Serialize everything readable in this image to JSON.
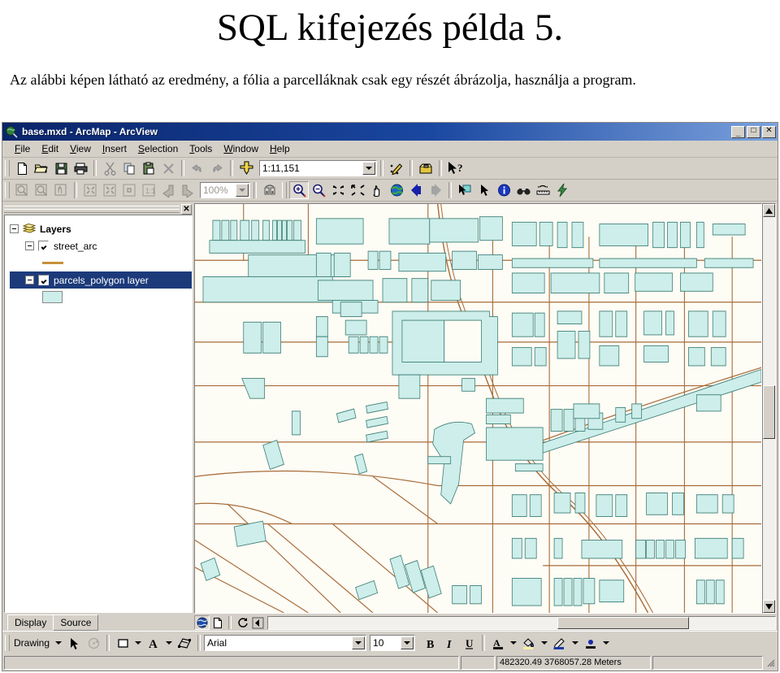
{
  "slide": {
    "title": "SQL kifejezés példa 5.",
    "subtitle": "Az alábbi képen látható az eredmény, a fólia a parcelláknak csak egy részét ábrázolja, használja a program."
  },
  "window": {
    "title": "base.mxd - ArcMap - ArcView",
    "app_icon": "arcmap-globe-icon",
    "controls": {
      "minimize": "_",
      "maximize": "□",
      "close": "✕"
    }
  },
  "menubar": {
    "items": [
      {
        "label": "File",
        "accel": "F"
      },
      {
        "label": "Edit",
        "accel": "E"
      },
      {
        "label": "View",
        "accel": "V"
      },
      {
        "label": "Insert",
        "accel": "I"
      },
      {
        "label": "Selection",
        "accel": "S"
      },
      {
        "label": "Tools",
        "accel": "T"
      },
      {
        "label": "Window",
        "accel": "W"
      },
      {
        "label": "Help",
        "accel": "H"
      }
    ]
  },
  "standard_toolbar": {
    "buttons": [
      {
        "name": "new-document-icon",
        "title": "New"
      },
      {
        "name": "open-folder-icon",
        "title": "Open"
      },
      {
        "name": "save-disk-icon",
        "title": "Save"
      },
      {
        "name": "print-icon",
        "title": "Print"
      },
      {
        "name": "cut-scissors-icon",
        "title": "Cut"
      },
      {
        "name": "copy-icon",
        "title": "Copy"
      },
      {
        "name": "paste-clipboard-icon",
        "title": "Paste"
      },
      {
        "name": "delete-x-icon",
        "title": "Delete"
      },
      {
        "name": "undo-arrow-icon",
        "title": "Undo"
      },
      {
        "name": "redo-arrow-icon",
        "title": "Redo"
      },
      {
        "name": "add-data-plus-icon",
        "title": "Add Data"
      }
    ],
    "scale": {
      "value": "1:11,151",
      "label": "Map Scale"
    },
    "right_buttons": [
      {
        "name": "editor-pencil-icon",
        "title": "Editor Toolbar"
      },
      {
        "name": "arctoolbox-icon",
        "title": "ArcToolbox"
      },
      {
        "name": "context-help-icon",
        "title": "What's This Help"
      }
    ]
  },
  "layout_toolbar": {
    "disabled": true,
    "zoom_value": "100%",
    "buttons": [
      {
        "name": "layout-zoom-in-icon"
      },
      {
        "name": "layout-zoom-out-icon"
      },
      {
        "name": "layout-pan-icon"
      },
      {
        "name": "zoom-whole-page-icon"
      },
      {
        "name": "zoom-page-width-icon"
      },
      {
        "name": "zoom-to-selected-icon"
      },
      {
        "name": "zoom-100-percent-icon"
      },
      {
        "name": "go-back-extent-icon"
      },
      {
        "name": "go-forward-extent-icon"
      },
      {
        "name": "toggle-draft-mode-icon"
      },
      {
        "name": "change-layout-icon"
      }
    ]
  },
  "tools_toolbar": {
    "buttons": [
      {
        "name": "zoom-in-icon",
        "title": "Zoom In",
        "active": true
      },
      {
        "name": "zoom-out-icon",
        "title": "Zoom Out",
        "active": false
      },
      {
        "name": "fixed-zoom-in-icon",
        "title": "Fixed Zoom In",
        "active": false
      },
      {
        "name": "fixed-zoom-out-icon",
        "title": "Fixed Zoom Out",
        "active": false
      },
      {
        "name": "pan-hand-icon",
        "title": "Pan",
        "active": false
      },
      {
        "name": "full-extent-globe-icon",
        "title": "Full Extent",
        "active": false
      },
      {
        "name": "back-extent-icon",
        "title": "Go Back To Previous Extent",
        "active": false
      },
      {
        "name": "forward-extent-icon",
        "title": "Go To Next Extent",
        "active": false
      },
      {
        "name": "select-features-icon",
        "title": "Select Features",
        "active": false
      },
      {
        "name": "select-elements-icon",
        "title": "Select Elements",
        "active": false
      },
      {
        "name": "identify-icon",
        "title": "Identify",
        "active": false
      },
      {
        "name": "find-binoculars-icon",
        "title": "Find",
        "active": false
      },
      {
        "name": "measure-icon",
        "title": "Measure",
        "active": false
      },
      {
        "name": "hyperlink-lightning-icon",
        "title": "Hyperlink",
        "active": false
      }
    ]
  },
  "toc": {
    "close_label": "✕",
    "tree": [
      {
        "label": "Layers",
        "level": 0,
        "bold": true,
        "checkbox": false,
        "selected": false,
        "icon": "layers-stack-icon"
      },
      {
        "label": "street_arc",
        "level": 1,
        "bold": false,
        "checkbox": true,
        "checked": true,
        "selected": false
      },
      {
        "label": "",
        "level": 2,
        "symbol": "line",
        "symbol_color": "#c8903c"
      },
      {
        "label": "parcels_polygon layer",
        "level": 1,
        "bold": false,
        "checkbox": true,
        "checked": true,
        "selected": true
      },
      {
        "label": "",
        "level": 2,
        "symbol": "polygon",
        "symbol_color": "#cdeeea"
      }
    ],
    "tabs": [
      {
        "label": "Display",
        "active": true
      },
      {
        "label": "Source",
        "active": false
      }
    ]
  },
  "map_view": {
    "view_buttons": [
      {
        "name": "data-view-icon",
        "active": true
      },
      {
        "name": "layout-view-icon",
        "active": false
      },
      {
        "name": "refresh-view-icon",
        "active": false
      },
      {
        "name": "pause-drawing-icon",
        "active": false
      }
    ],
    "scrollbars": {
      "vertical_thumb_pct": 48,
      "horizontal_thumb_pct": 62
    },
    "layer_colors": {
      "parcel_fill": "#cdeeea",
      "parcel_outline": "#3e7f77",
      "street_line": "#a86b38",
      "background": "#fdfcf5"
    }
  },
  "drawing_toolbar": {
    "menu_label": "Drawing",
    "font_name": "Arial",
    "font_size": "10",
    "bold_label": "B",
    "italic_label": "I",
    "underline_label": "U",
    "buttons": [
      {
        "name": "select-elements-arrow-icon"
      },
      {
        "name": "rotate-element-icon"
      },
      {
        "name": "new-rectangle-icon"
      },
      {
        "name": "new-text-icon"
      },
      {
        "name": "draw-order-icon"
      },
      {
        "name": "font-color-icon"
      },
      {
        "name": "fill-color-icon"
      },
      {
        "name": "line-color-icon"
      },
      {
        "name": "marker-color-icon"
      }
    ]
  },
  "statusbar": {
    "left_text": "",
    "coordinates": "482320.49  3768057.28 Meters",
    "right_text": ""
  }
}
